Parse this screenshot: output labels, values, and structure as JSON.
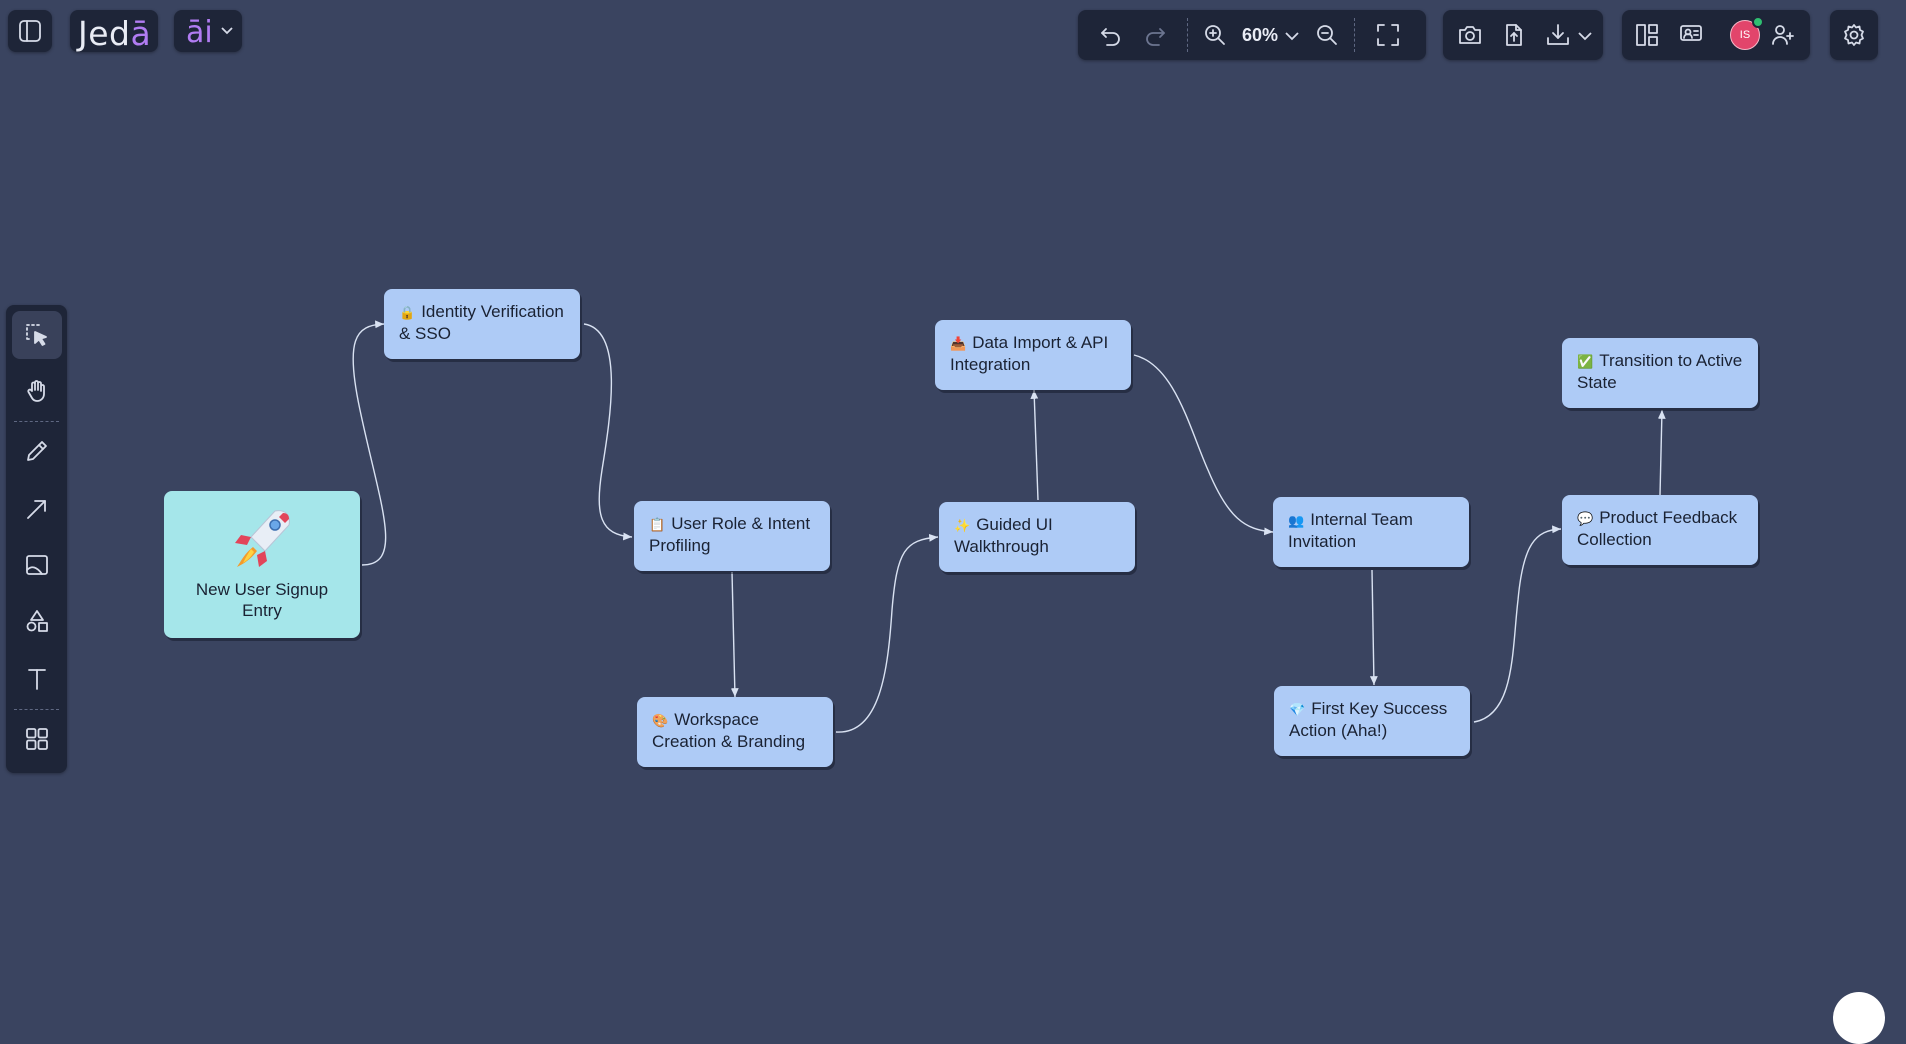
{
  "brand": {
    "logo_main": "Jed",
    "logo_accent": "ā",
    "ai_label": "āi"
  },
  "toolbar": {
    "zoom_label": "60%",
    "avatar_initials": "IS"
  },
  "icons": {
    "sidebar_toggle": "sidebar-toggle-icon",
    "undo": "undo-icon",
    "redo": "redo-icon",
    "zoom_in": "zoom-in-icon",
    "zoom_out": "zoom-out-icon",
    "fit": "fit-screen-icon",
    "camera": "camera-icon",
    "share": "share-upload-icon",
    "download": "download-icon",
    "layout": "layout-icon",
    "present": "present-icon",
    "add_user": "add-user-icon",
    "settings": "gear-icon"
  },
  "tools": [
    "select",
    "hand",
    "pen",
    "arrow",
    "image",
    "shapes",
    "text",
    "components"
  ],
  "nodes": {
    "start": {
      "label": "New User Signup Entry"
    },
    "identity": {
      "emoji": "🔒",
      "label": "Identity Verification & SSO"
    },
    "role": {
      "emoji": "📋",
      "label": "User Role & Intent Profiling"
    },
    "workspace": {
      "emoji": "🎨",
      "label": "Workspace Creation & Branding"
    },
    "guided": {
      "emoji": "✨",
      "label": "Guided UI Walkthrough"
    },
    "import": {
      "emoji": "📥",
      "label": "Data Import & API Integration"
    },
    "team": {
      "emoji": "👥",
      "label": "Internal Team Invitation"
    },
    "aha": {
      "emoji": "💎",
      "label": "First Key Success Action (Aha!)"
    },
    "feedback": {
      "emoji": "💬",
      "label": "Product Feedback Collection"
    },
    "active": {
      "emoji": "✅",
      "label": "Transition to Active State"
    }
  },
  "colors": {
    "canvas": "#3a4460",
    "panel": "#1e2538",
    "node": "#aecbf6",
    "start_node": "#a5e6ea",
    "accent": "#b17cf2",
    "edge": "#d9e2f2"
  }
}
